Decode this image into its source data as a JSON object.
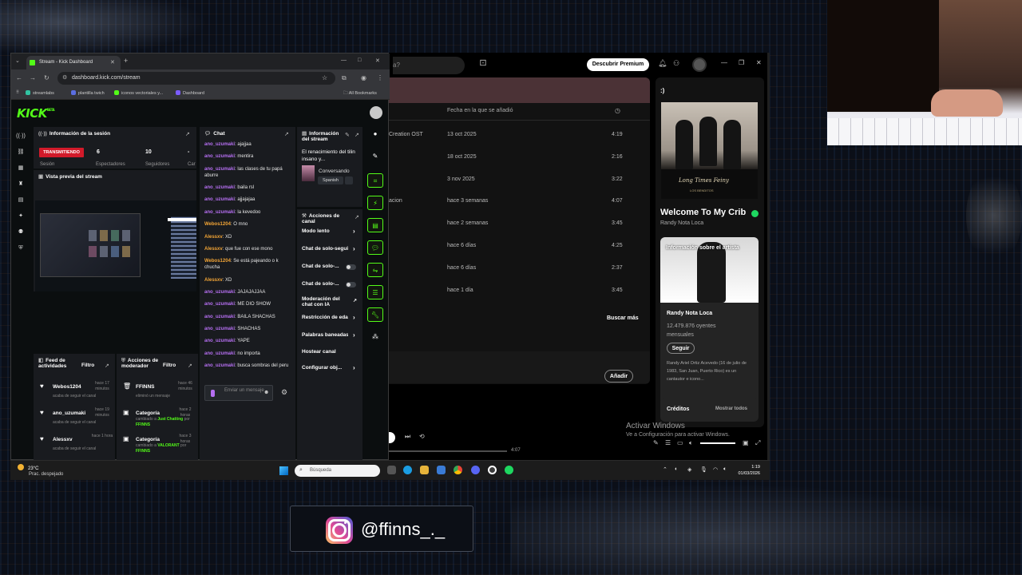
{
  "browser": {
    "tab_title": "Stream - Kick Dashboard",
    "url": "dashboard.kick.com/stream",
    "bookmarks": [
      {
        "label": "streamlabs",
        "color": "#31c3a2"
      },
      {
        "label": "plantilla twich",
        "color": "#5b6ee1"
      },
      {
        "label": "iconos vectoriales y...",
        "color": "#53fc18"
      },
      {
        "label": "Dashboard",
        "color": "#7b5cff"
      }
    ],
    "all_bookmarks": "All Bookmarks"
  },
  "kick": {
    "logo": "KICK",
    "logo_beta": "BETA",
    "session": {
      "title": "Información de la sesión",
      "status": "TRANSMITIENDO",
      "stats": [
        {
          "value": "6",
          "label": "Espectadores"
        },
        {
          "value": "10",
          "label": "Seguidores"
        },
        {
          "value": "-",
          "label": "Car"
        }
      ],
      "first_label": "Sesión"
    },
    "preview": {
      "title": "Vista previa del stream"
    },
    "feed": {
      "title": "Feed de actividades",
      "filter": "Filtro",
      "items": [
        {
          "name": "Webos1204",
          "time": "hace 17 minutos",
          "text": "acaba de seguir el canal"
        },
        {
          "name": "ano_uzumaki",
          "time": "hace 19 minutos",
          "text": "acaba de seguir el canal"
        },
        {
          "name": "Alessxv",
          "time": "hace 1 hora",
          "text": "acaba de seguir el canal"
        }
      ]
    },
    "mod_actions": {
      "title": "Acciones de moderador",
      "filter": "Filtro",
      "items": [
        {
          "name": "FFINNS",
          "time": "hace 46 minutos",
          "text": "eliminó un mensaje",
          "extra": "",
          "extra2": ""
        },
        {
          "name": "Categoría",
          "time": "hace 2 horas",
          "text": "cambiado a",
          "extra": "Just Chatting",
          "extra2": "FFINNS"
        },
        {
          "name": "Categoría",
          "time": "hace 3 horas",
          "text": "cambiado a",
          "extra": "VALORANT",
          "extra2": "FFINNS"
        }
      ],
      "por": "por"
    },
    "chat": {
      "title": "Chat",
      "messages": [
        {
          "user": "ano_uzumaki",
          "color": "#b66ff2",
          "text": "ajajjaa"
        },
        {
          "user": "ano_uzumaki",
          "color": "#b66ff2",
          "text": "mentira"
        },
        {
          "user": "ano_uzumaki",
          "color": "#b66ff2",
          "text": "las clases de tu papá aburre"
        },
        {
          "user": "ano_uzumaki",
          "color": "#b66ff2",
          "text": "baila rsl"
        },
        {
          "user": "ano_uzumaki",
          "color": "#b66ff2",
          "text": "ajjajajaa"
        },
        {
          "user": "ano_uzumaki",
          "color": "#b66ff2",
          "text": "la kevedoo"
        },
        {
          "user": "Webos1204",
          "color": "#f3a536",
          "text": "O mno"
        },
        {
          "user": "Alessxv",
          "color": "#f3a536",
          "text": "XD"
        },
        {
          "user": "Alessxv",
          "color": "#f3a536",
          "text": "que fue con ese mono"
        },
        {
          "user": "Webos1204",
          "color": "#f3a536",
          "text": "Se está pajeando o k chucha"
        },
        {
          "user": "Alessxv",
          "color": "#f3a536",
          "text": "XD"
        },
        {
          "user": "ano_uzumaki",
          "color": "#b66ff2",
          "text": "JAJAJAJJAA"
        },
        {
          "user": "ano_uzumaki",
          "color": "#b66ff2",
          "text": "ME DIO SHOW"
        },
        {
          "user": "ano_uzumaki",
          "color": "#b66ff2",
          "text": "BAILA SHACHAS"
        },
        {
          "user": "ano_uzumaki",
          "color": "#b66ff2",
          "text": "SHACHAS"
        },
        {
          "user": "ano_uzumaki",
          "color": "#b66ff2",
          "text": "YAPE"
        },
        {
          "user": "ano_uzumaki",
          "color": "#b66ff2",
          "text": "no importa"
        },
        {
          "user": "ano_uzumaki",
          "color": "#b66ff2",
          "text": "busca sombras del peru"
        }
      ],
      "input_placeholder": "Enviar un mensaje"
    },
    "stream_info": {
      "title": "Información del stream",
      "stream_title": "El renacimiento del tilin insano y...",
      "category": "Conversando",
      "tag": "Spanish"
    },
    "channel_actions": {
      "title": "Acciones de canal",
      "items": [
        {
          "label": "Modo lento",
          "control": "arrow"
        },
        {
          "label": "Chat de solo-seguidores",
          "control": "arrow"
        },
        {
          "label": "Chat de solo-...",
          "control": "toggle"
        },
        {
          "label": "Chat de solo-...",
          "control": "toggle"
        },
        {
          "label": "Moderación del chat con IA",
          "control": "external"
        },
        {
          "label": "Restricción de edad",
          "control": "arrow"
        },
        {
          "label": "Palabras baneadas",
          "control": "arrow"
        },
        {
          "label": "Hostear canal",
          "control": "none"
        },
        {
          "label": "Configurar obj...",
          "control": "arrow"
        }
      ]
    }
  },
  "spotify": {
    "search_placeholder": "¿Qué quieres reproducir?",
    "search_visible": "a?",
    "premium_button": "Descubrir Premium",
    "header": {
      "date_col": "Fecha en la que se añadió",
      "duration_icon": "clock-icon"
    },
    "rows": [
      {
        "album": "Creation OST",
        "date": "13 oct 2025",
        "duration": "4:19"
      },
      {
        "album": "",
        "date": "18 oct 2025",
        "duration": "2:16"
      },
      {
        "album": "",
        "date": "3 nov 2025",
        "duration": "3:22"
      },
      {
        "album": "acion",
        "date": "hace 3 semanas",
        "duration": "4:07"
      },
      {
        "album": "",
        "date": "hace 2 semanas",
        "duration": "3:45"
      },
      {
        "album": "",
        "date": "hace 6 días",
        "duration": "4:25"
      },
      {
        "album": "",
        "date": "hace 6 días",
        "duration": "2:37"
      },
      {
        "album": "",
        "date": "hace 1 día",
        "duration": "3:45"
      }
    ],
    "search_more": "Buscar más",
    "add_button": "Añadir",
    "now_playing": {
      "header": ":)",
      "album_text": "Long Times Feiny",
      "album_sub": "LOS BENDITOS",
      "title": "Welcome To My Crib",
      "artist": "Randy Nota Loca",
      "about_label": "Información sobre el artista",
      "artist_name": "Randy Nota Loca",
      "listeners": "12.479.876 oyentes mensuales",
      "follow": "Seguir",
      "bio": "Randy Ariel Ortiz Acevedo (16 de julio de 1983, San Juan, Puerto Rico) es un cantautor e icono...",
      "credits": "Créditos",
      "show_all": "Mostrar todos"
    },
    "player_time": "4:07"
  },
  "windows": {
    "activate_title": "Activar Windows",
    "activate_sub": "Ve a Configuración para activar Windows.",
    "weather_temp": "23°C",
    "weather_desc": "Prac. despejado",
    "search": "Búsqueda",
    "time": "1:19",
    "date": "01/03/2026"
  },
  "overlay": {
    "instagram_handle": "@ffinns_._"
  }
}
